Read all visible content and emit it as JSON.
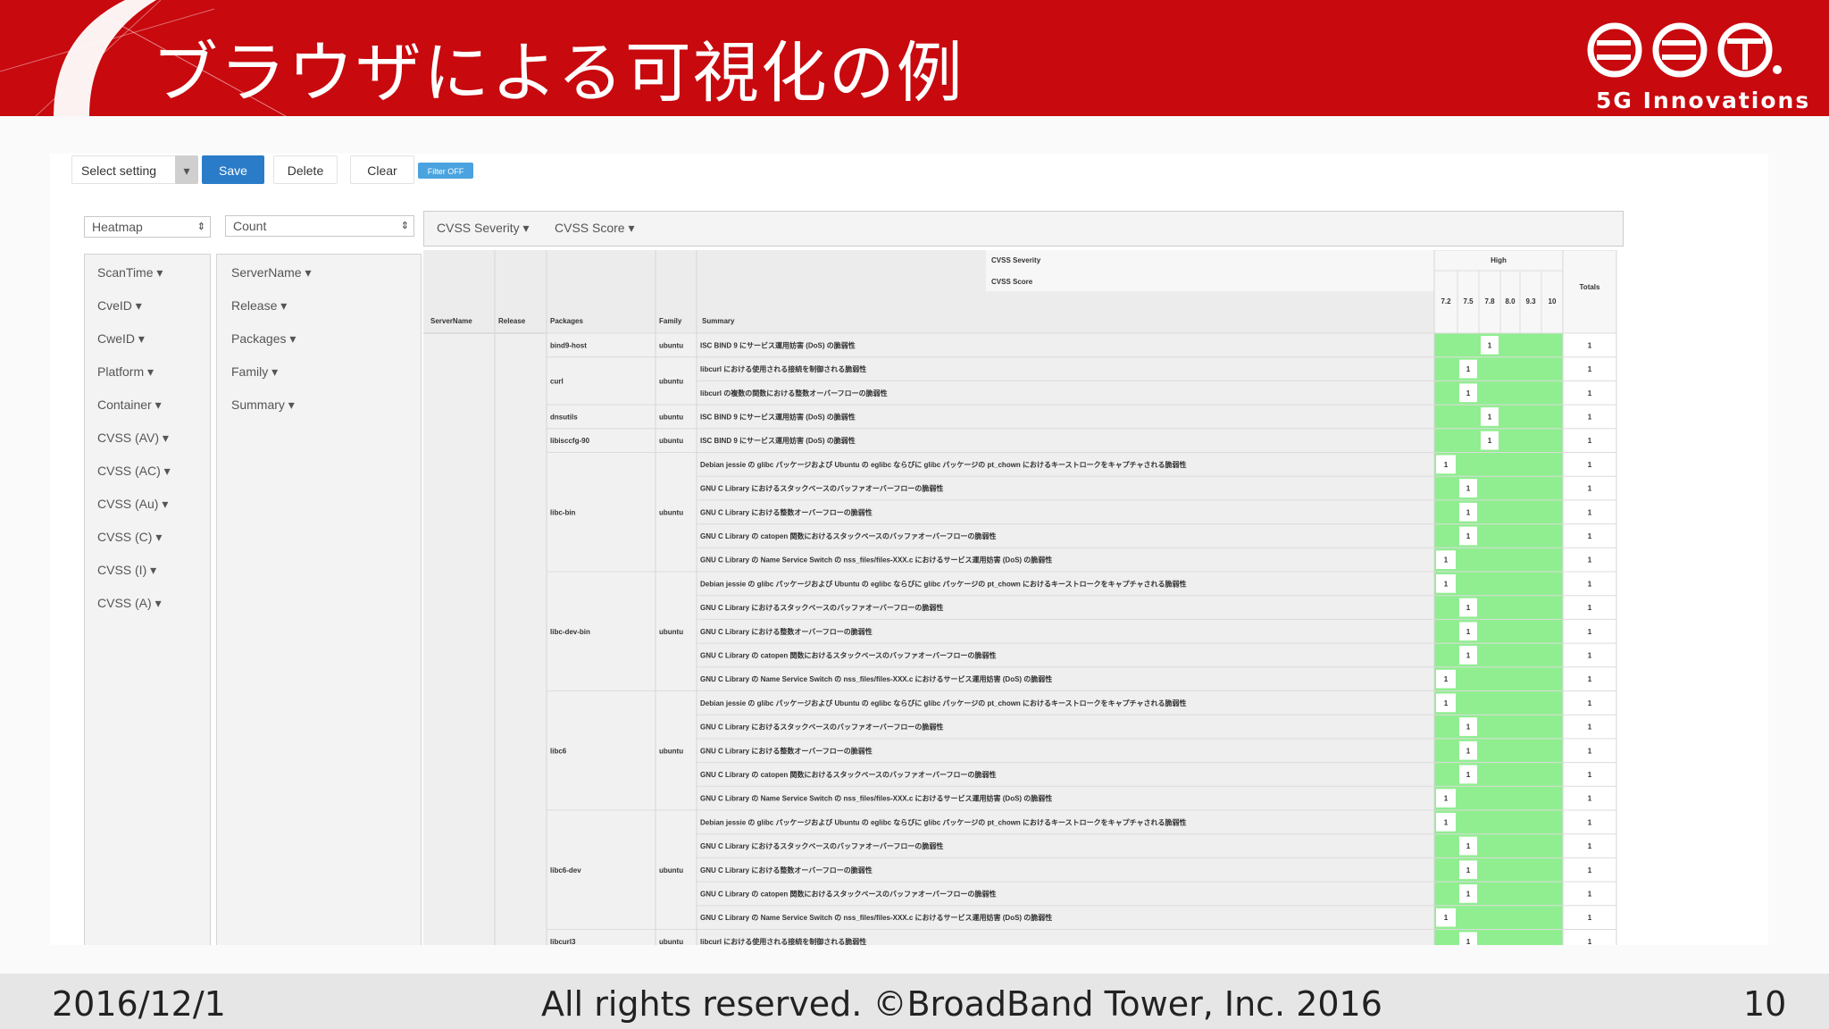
{
  "slide": {
    "title": "ブラウザによる可視化の例",
    "logo_subtitle": "5G Innovations",
    "footer": {
      "date": "2016/12/1",
      "copyright": "All rights reserved. ©BroadBand Tower, Inc. 2016",
      "page": "10"
    }
  },
  "toolbar": {
    "select_setting": "Select setting",
    "caret": "▾",
    "save": "Save",
    "delete": "Delete",
    "clear": "Clear",
    "filter": "Filter OFF"
  },
  "controls": {
    "renderer": "Heatmap",
    "aggregator": "Count"
  },
  "attributes_left": [
    "ScanTime ▾",
    "CveID ▾",
    "CweID ▾",
    "Platform ▾",
    "Container ▾",
    "CVSS (AV) ▾",
    "CVSS (AC) ▾",
    "CVSS (Au) ▾",
    "CVSS (C) ▾",
    "CVSS (I) ▾",
    "CVSS (A) ▾"
  ],
  "attributes_right": [
    "ServerName ▾",
    "Release ▾",
    "Packages ▾",
    "Family ▾",
    "Summary ▾"
  ],
  "column_attributes": [
    "CVSS Severity ▾",
    "CVSS Score ▾"
  ],
  "pivot": {
    "col_attr_labels": [
      "CVSS Severity",
      "CVSS Score"
    ],
    "severity_header": "High",
    "score_headers": [
      "7.2",
      "7.5",
      "7.8",
      "8.0",
      "9.3",
      "10"
    ],
    "totals_header": "Totals",
    "row_headers": [
      "ServerName",
      "Release",
      "Packages",
      "Family",
      "Summary"
    ],
    "packages": [
      {
        "name": "bind9-host",
        "family": "ubuntu",
        "rows": 1
      },
      {
        "name": "curl",
        "family": "ubuntu",
        "rows": 2
      },
      {
        "name": "dnsutils",
        "family": "ubuntu",
        "rows": 1
      },
      {
        "name": "libisccfg-90",
        "family": "ubuntu",
        "rows": 1
      },
      {
        "name": "libc-bin",
        "family": "ubuntu",
        "rows": 5
      },
      {
        "name": "libc-dev-bin",
        "family": "ubuntu",
        "rows": 5
      },
      {
        "name": "libc6",
        "family": "ubuntu",
        "rows": 5
      },
      {
        "name": "libc6-dev",
        "family": "ubuntu",
        "rows": 5
      },
      {
        "name": "libcurl3",
        "family": "ubuntu",
        "rows": 1
      }
    ],
    "summaries": [
      "ISC BIND 9 にサービス運用妨害 (DoS) の脆弱性",
      "libcurl における使用される接続を制御される脆弱性",
      "libcurl の複数の関数における整数オーバーフローの脆弱性",
      "ISC BIND 9 にサービス運用妨害 (DoS) の脆弱性",
      "ISC BIND 9 にサービス運用妨害 (DoS) の脆弱性",
      "Debian jessie の glibc パッケージおよび Ubuntu の eglibc ならびに glibc パッケージの pt_chown におけるキーストロークをキャプチャされる脆弱性",
      "GNU C Library におけるスタックベースのバッファオーバーフローの脆弱性",
      "GNU C Library における整数オーバーフローの脆弱性",
      "GNU C Library の catopen 関数におけるスタックベースのバッファオーバーフローの脆弱性",
      "GNU C Library の Name Service Switch の nss_files/files-XXX.c におけるサービス運用妨害 (DoS) の脆弱性",
      "Debian jessie の glibc パッケージおよび Ubuntu の eglibc ならびに glibc パッケージの pt_chown におけるキーストロークをキャプチャされる脆弱性",
      "GNU C Library におけるスタックベースのバッファオーバーフローの脆弱性",
      "GNU C Library における整数オーバーフローの脆弱性",
      "GNU C Library の catopen 関数におけるスタックベースのバッファオーバーフローの脆弱性",
      "GNU C Library の Name Service Switch の nss_files/files-XXX.c におけるサービス運用妨害 (DoS) の脆弱性",
      "Debian jessie の glibc パッケージおよび Ubuntu の eglibc ならびに glibc パッケージの pt_chown におけるキーストロークをキャプチャされる脆弱性",
      "GNU C Library におけるスタックベースのバッファオーバーフローの脆弱性",
      "GNU C Library における整数オーバーフローの脆弱性",
      "GNU C Library の catopen 関数におけるスタックベースのバッファオーバーフローの脆弱性",
      "GNU C Library の Name Service Switch の nss_files/files-XXX.c におけるサービス運用妨害 (DoS) の脆弱性",
      "Debian jessie の glibc パッケージおよび Ubuntu の eglibc ならびに glibc パッケージの pt_chown におけるキーストロークをキャプチャされる脆弱性",
      "GNU C Library におけるスタックベースのバッファオーバーフローの脆弱性",
      "GNU C Library における整数オーバーフローの脆弱性",
      "GNU C Library の catopen 関数におけるスタックベースのバッファオーバーフローの脆弱性",
      "GNU C Library の Name Service Switch の nss_files/files-XXX.c におけるサービス運用妨害 (DoS) の脆弱性",
      "libcurl における使用される接続を制御される脆弱性"
    ],
    "cell_value": "1",
    "row_score_col": [
      2,
      1,
      1,
      2,
      2,
      0,
      1,
      1,
      1,
      0,
      0,
      1,
      1,
      1,
      0,
      0,
      1,
      1,
      1,
      0,
      0,
      1,
      1,
      1,
      0,
      1
    ],
    "heat_color": "#90ee90"
  }
}
